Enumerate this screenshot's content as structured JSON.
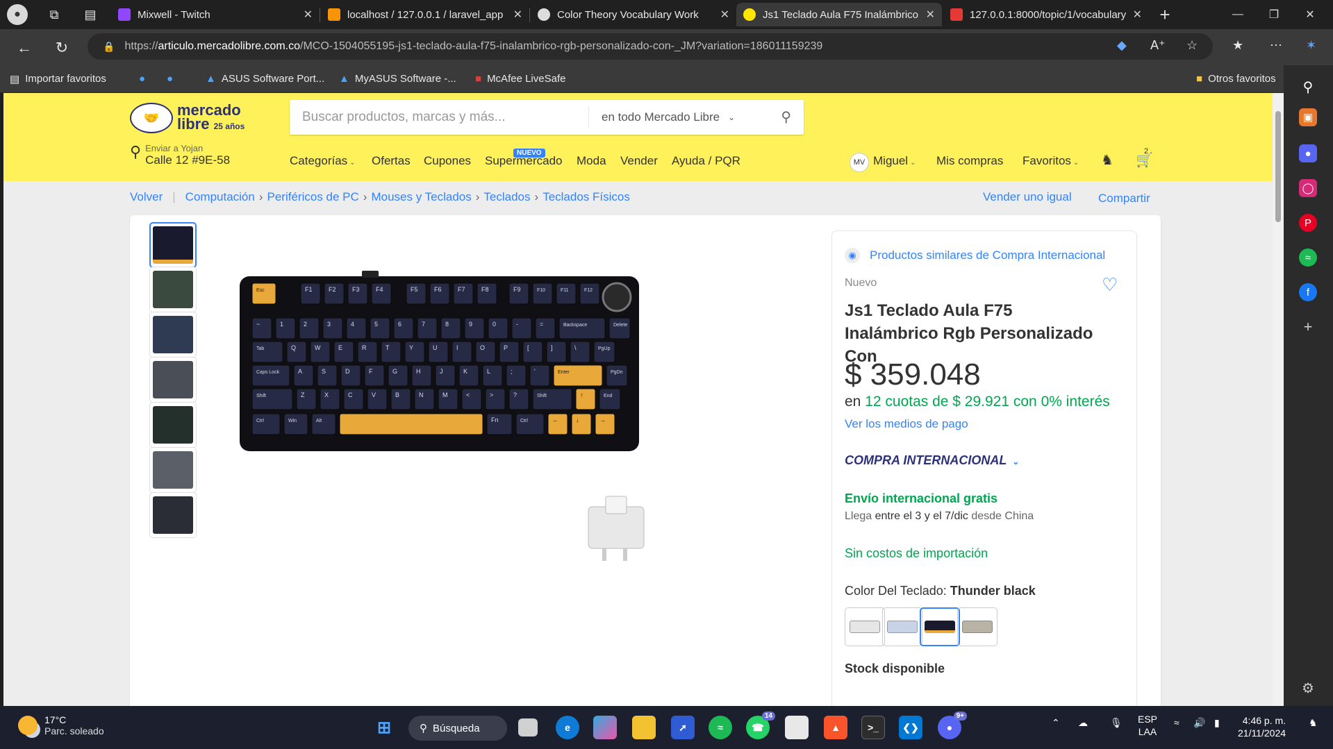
{
  "browser": {
    "tabs": [
      {
        "title": "Mixwell - Twitch",
        "color": "#9146ff",
        "active": false
      },
      {
        "title": "localhost / 127.0.0.1 / laravel_app",
        "color": "#f89406",
        "active": false
      },
      {
        "title": "Color Theory Vocabulary Work",
        "color": "#dddddd",
        "active": false
      },
      {
        "title": "Js1 Teclado Aula F75 Inalámbrico",
        "color": "#ffe600",
        "active": true
      },
      {
        "title": "127.0.0.1:8000/topic/1/vocabulary",
        "color": "#e53935",
        "active": false
      }
    ],
    "url_prefix": "https://",
    "url_host": "articulo.mercadolibre.com.co",
    "url_path": "/MCO-1504055195-js1-teclado-aula-f75-inalambrico-rgb-personalizado-con-_JM?variation=186011159239",
    "bookmarks": {
      "import": "Importar favoritos",
      "asus": "ASUS Software Port...",
      "myasus": "MyASUS Software -...",
      "mcafee": "McAfee LiveSafe",
      "others": "Otros favoritos"
    }
  },
  "header": {
    "logo_line1": "mercado",
    "logo_line2": "libre",
    "logo_badge": "25 años",
    "search_placeholder": "Buscar productos, marcas y más...",
    "search_scope": "en todo Mercado Libre",
    "address_label": "Enviar a Yojan",
    "address_value": "Calle 12 #9E-58",
    "nav": {
      "categorias": "Categorías",
      "ofertas": "Ofertas",
      "cupones": "Cupones",
      "supermercado": "Supermercado",
      "nuevo": "NUEVO",
      "moda": "Moda",
      "vender": "Vender",
      "ayuda": "Ayuda / PQR"
    },
    "user_initials": "MV",
    "user_name": "Miguel",
    "mis_compras": "Mis compras",
    "favoritos": "Favoritos",
    "cart_count": "2"
  },
  "breadcrumb": {
    "back": "Volver",
    "items": [
      "Computación",
      "Periféricos de PC",
      "Mouses y Teclados",
      "Teclados",
      "Teclados Físicos"
    ],
    "sell_same": "Vender uno igual",
    "share": "Compartir"
  },
  "product": {
    "similar_link": "Productos similares de Compra Internacional",
    "condition": "Nuevo",
    "title": "Js1 Teclado Aula F75 Inalámbrico Rgb Personalizado Con",
    "price": "$ 359.048",
    "installments_prefix": "en",
    "installments_text": "12 cuotas de $ 29.921 con 0% interés",
    "payment_link": "Ver los medios de pago",
    "international": "COMPRA INTERNACIONAL",
    "shipping": "Envío internacional gratis",
    "arrive_prefix": "Llega",
    "arrive_dates": "entre el 3 y el 7/dic",
    "arrive_from": "desde China",
    "no_import_cost": "Sin costos de importación",
    "color_label": "Color Del Teclado:",
    "color_value": "Thunder black",
    "swatch_colors": [
      "#e6e6e6",
      "#c9d3e8",
      "#1a1a2e",
      "#b9b3a6"
    ],
    "selected_swatch": 2,
    "stock": "Stock disponible"
  },
  "keyboard": {
    "rows": [
      [
        "Esc",
        "F1",
        "F2",
        "F3",
        "F4",
        "F5",
        "F6",
        "F7",
        "F8",
        "F9",
        "F10",
        "F11",
        "F12"
      ],
      [
        "~",
        "1",
        "2",
        "3",
        "4",
        "5",
        "6",
        "7",
        "8",
        "9",
        "0",
        "-",
        "=",
        "Backspace",
        "Delete"
      ],
      [
        "Tab",
        "Q",
        "W",
        "E",
        "R",
        "T",
        "Y",
        "U",
        "I",
        "O",
        "P",
        "[",
        "]",
        "\\",
        "PgUp"
      ],
      [
        "Caps Lock",
        "A",
        "S",
        "D",
        "F",
        "G",
        "H",
        "J",
        "K",
        "L",
        ";",
        "'",
        "Enter",
        "PgDn"
      ],
      [
        "Shift",
        "Z",
        "X",
        "C",
        "V",
        "B",
        "N",
        "M",
        "<",
        ">",
        "?",
        "Shift",
        "↑",
        "End"
      ],
      [
        "Ctrl",
        "Win",
        "Alt",
        "",
        "Fn",
        "Ctrl",
        "←",
        "↓",
        "→"
      ]
    ]
  },
  "taskbar": {
    "temp": "17°C",
    "weather": "Parc. soleado",
    "search": "Búsqueda",
    "whatsapp_badge": "14",
    "discord_badge": "9+",
    "lang1": "ESP",
    "lang2": "LAA",
    "time": "4:46 p. m.",
    "date": "21/11/2024"
  }
}
